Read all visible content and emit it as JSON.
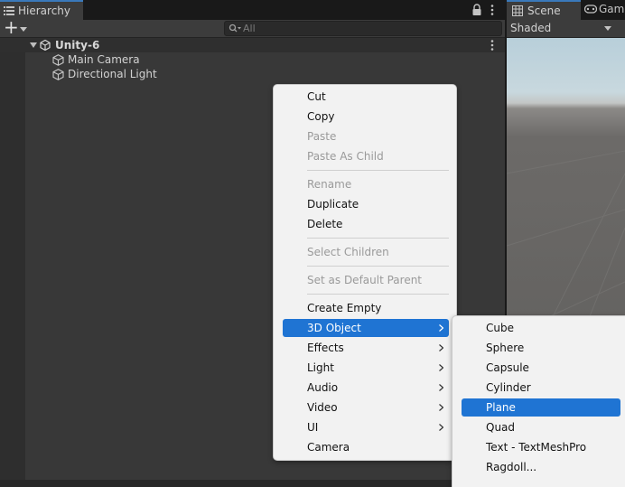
{
  "hierarchy": {
    "tab_label": "Hierarchy",
    "add_label": "+",
    "search_placeholder": "All",
    "scene": {
      "name": "Unity-6"
    },
    "objects": [
      {
        "name": "Main Camera"
      },
      {
        "name": "Directional Light"
      }
    ]
  },
  "scene_panel": {
    "tabs": [
      {
        "label": "Scene"
      },
      {
        "label": "Game"
      }
    ],
    "shading_mode": "Shaded"
  },
  "context_menu": {
    "items": [
      {
        "label": "Cut",
        "enabled": true
      },
      {
        "label": "Copy",
        "enabled": true
      },
      {
        "label": "Paste",
        "enabled": false
      },
      {
        "label": "Paste As Child",
        "enabled": false
      },
      {
        "label": "Rename",
        "enabled": false
      },
      {
        "label": "Duplicate",
        "enabled": true
      },
      {
        "label": "Delete",
        "enabled": true
      },
      {
        "label": "Select Children",
        "enabled": false
      },
      {
        "label": "Set as Default Parent",
        "enabled": false
      },
      {
        "label": "Create Empty",
        "enabled": true
      },
      {
        "label": "3D Object",
        "enabled": true,
        "submenu": true,
        "highlighted": true
      },
      {
        "label": "Effects",
        "enabled": true,
        "submenu": true
      },
      {
        "label": "Light",
        "enabled": true,
        "submenu": true
      },
      {
        "label": "Audio",
        "enabled": true,
        "submenu": true
      },
      {
        "label": "Video",
        "enabled": true,
        "submenu": true
      },
      {
        "label": "UI",
        "enabled": true,
        "submenu": true
      },
      {
        "label": "Camera",
        "enabled": true
      }
    ]
  },
  "submenu_3d": {
    "items": [
      {
        "label": "Cube"
      },
      {
        "label": "Sphere"
      },
      {
        "label": "Capsule"
      },
      {
        "label": "Cylinder"
      },
      {
        "label": "Plane",
        "highlighted": true
      },
      {
        "label": "Quad"
      },
      {
        "label": "Text - TextMeshPro"
      },
      {
        "label": "Ragdoll..."
      }
    ]
  },
  "colors": {
    "accent_blue": "#1f74d3",
    "tab_active_line": "#3a79bb",
    "panel_bg": "#383838",
    "menu_bg": "#f2f2f2"
  },
  "icons": {
    "hierarchy_tab": "list-icon",
    "lock": "lock-icon",
    "menu": "kebab-icon",
    "search": "search-icon",
    "scene": "unity-scene-icon",
    "gameobject": "cube-icon",
    "scene_tab": "grid-icon",
    "game_tab": "gamepad-icon"
  }
}
